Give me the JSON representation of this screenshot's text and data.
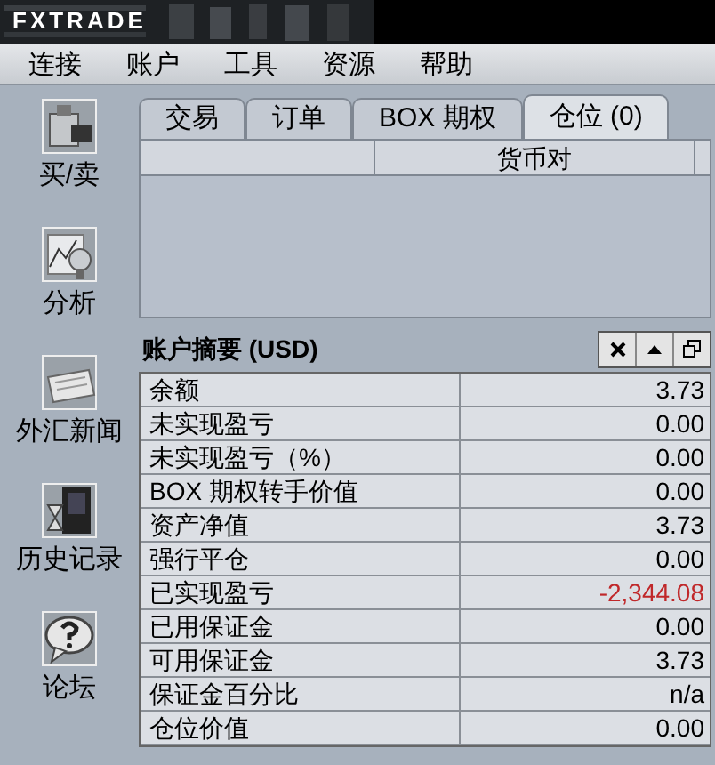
{
  "header": {
    "logo": "FXTRADE"
  },
  "menu": [
    "连接",
    "账户",
    "工具",
    "资源",
    "帮助"
  ],
  "sidebar": [
    {
      "label": "买/卖",
      "kind": "trade"
    },
    {
      "label": "分析",
      "kind": "chart"
    },
    {
      "label": "外汇新闻",
      "kind": "news"
    },
    {
      "label": "历史记录",
      "kind": "history"
    },
    {
      "label": "论坛",
      "kind": "forum"
    }
  ],
  "tabs": [
    {
      "label": "交易",
      "selected": false
    },
    {
      "label": "订单",
      "selected": false
    },
    {
      "label": "BOX 期权",
      "selected": false
    },
    {
      "label": "仓位 (0)",
      "selected": true
    }
  ],
  "positions_table": {
    "columns": [
      "货币对"
    ]
  },
  "summary": {
    "title": "账户摘要 (USD)",
    "rows": [
      {
        "label": "余额",
        "value": "3.73",
        "negative": false
      },
      {
        "label": "未实现盈亏",
        "value": "0.00",
        "negative": false
      },
      {
        "label": "未实现盈亏（%）",
        "value": "0.00",
        "negative": false
      },
      {
        "label": "BOX 期权转手价值",
        "value": "0.00",
        "negative": false
      },
      {
        "label": "资产净值",
        "value": "3.73",
        "negative": false
      },
      {
        "label": "强行平仓",
        "value": "0.00",
        "negative": false
      },
      {
        "label": "已实现盈亏",
        "value": "-2,344.08",
        "negative": true
      },
      {
        "label": "已用保证金",
        "value": "0.00",
        "negative": false
      },
      {
        "label": "可用保证金",
        "value": "3.73",
        "negative": false
      },
      {
        "label": "保证金百分比",
        "value": "n/a",
        "negative": false
      },
      {
        "label": "仓位价值",
        "value": "0.00",
        "negative": false
      }
    ]
  }
}
